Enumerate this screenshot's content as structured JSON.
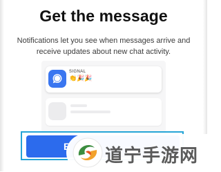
{
  "dialog": {
    "title": "Get the message",
    "description": "Notifications let you see when messages arrive and receive updates about new chat activity."
  },
  "preview": {
    "notification": {
      "app_name": "SIGNAL",
      "message": "👏🎉🎉",
      "icon": "signal-chat-bubble-icon"
    },
    "placeholder_icon": "blank-avatar"
  },
  "button": {
    "label_visible": "E",
    "accent_color": "#2c6bed",
    "focus_color": "#25a4d6"
  },
  "watermark": {
    "text": "道宁手游网",
    "icon": "swirl-logo"
  }
}
